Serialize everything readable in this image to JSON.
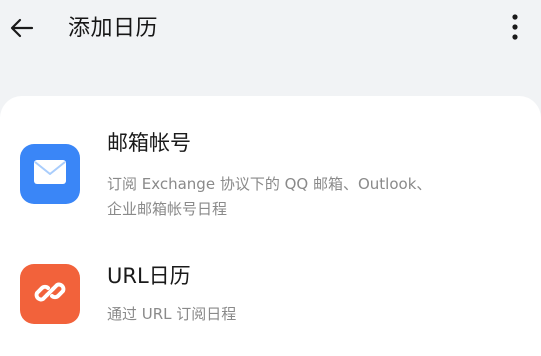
{
  "header": {
    "title": "添加日历",
    "back_icon": "arrow-left-icon",
    "more_icon": "more-vertical-icon"
  },
  "options": [
    {
      "title": "邮箱帐号",
      "description_line1": "订阅 Exchange 协议下的 QQ 邮箱、Outlook、",
      "description_line2": "企业邮箱帐号日程",
      "icon": "envelope-icon",
      "icon_color": "#3a86f7"
    },
    {
      "title": "URL日历",
      "description_line1": "通过 URL 订阅日程",
      "icon": "link-icon",
      "icon_color": "#f2623b"
    }
  ]
}
